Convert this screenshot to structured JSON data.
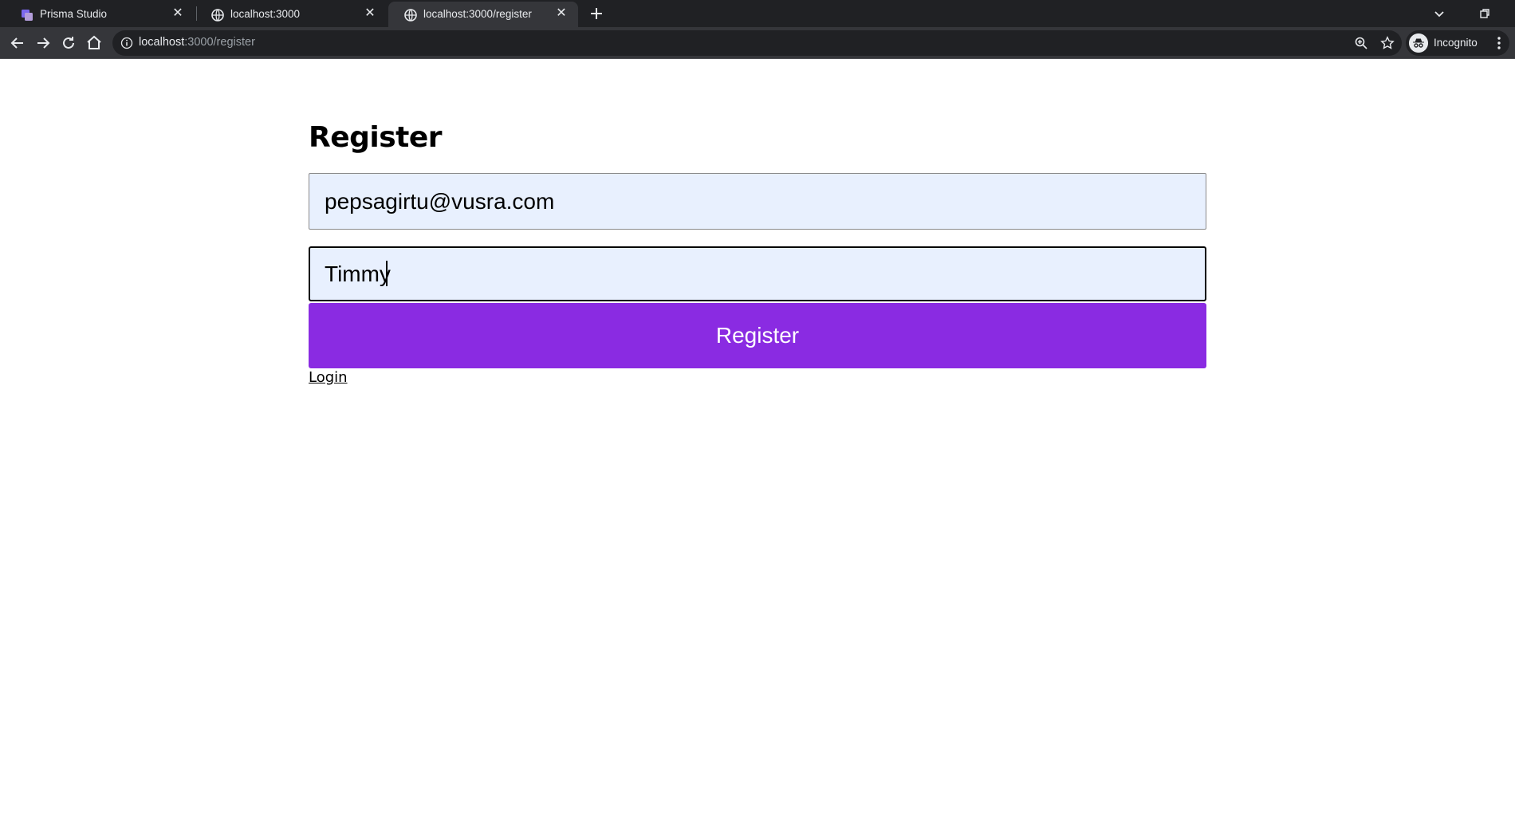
{
  "browser": {
    "tabs": [
      {
        "title": "Prisma Studio",
        "icon": "prisma-icon",
        "active": false
      },
      {
        "title": "localhost:3000",
        "icon": "globe-icon",
        "active": false
      },
      {
        "title": "localhost:3000/register",
        "icon": "globe-icon",
        "active": true
      }
    ],
    "address_bar": {
      "host": "localhost",
      "path": ":3000/register"
    },
    "profile_label": "Incognito"
  },
  "page": {
    "heading": "Register",
    "email_field": {
      "value": "pepsagirtu@vusra.com"
    },
    "name_field": {
      "value": "Timmy"
    },
    "register_button_label": "Register",
    "login_link_label": "Login",
    "colors": {
      "button_bg": "#8a2be2",
      "autofill_bg": "#e8f0fe"
    }
  }
}
